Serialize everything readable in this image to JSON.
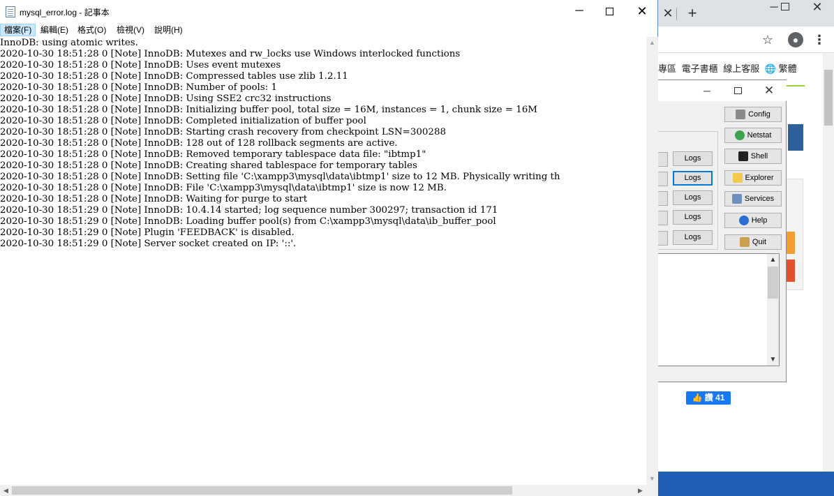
{
  "notepad": {
    "title": "mysql_error.log - 記事本",
    "controls": {
      "minimize": "─",
      "close": "✕"
    },
    "menu": [
      "檔案(F)",
      "編輯(E)",
      "格式(O)",
      "檢視(V)",
      "說明(H)"
    ],
    "lines": [
      "InnoDB: using atomic writes.",
      "2020-10-30 18:51:28 0 [Note] InnoDB: Mutexes and rw_locks use Windows interlocked functions",
      "2020-10-30 18:51:28 0 [Note] InnoDB: Uses event mutexes",
      "2020-10-30 18:51:28 0 [Note] InnoDB: Compressed tables use zlib 1.2.11",
      "2020-10-30 18:51:28 0 [Note] InnoDB: Number of pools: 1",
      "2020-10-30 18:51:28 0 [Note] InnoDB: Using SSE2 crc32 instructions",
      "2020-10-30 18:51:28 0 [Note] InnoDB: Initializing buffer pool, total size = 16M, instances = 1, chunk size = 16M",
      "2020-10-30 18:51:28 0 [Note] InnoDB: Completed initialization of buffer pool",
      "2020-10-30 18:51:28 0 [Note] InnoDB: Starting crash recovery from checkpoint LSN=300288",
      "2020-10-30 18:51:28 0 [Note] InnoDB: 128 out of 128 rollback segments are active.",
      "2020-10-30 18:51:28 0 [Note] InnoDB: Removed temporary tablespace data file: \"ibtmp1\"",
      "2020-10-30 18:51:28 0 [Note] InnoDB: Creating shared tablespace for temporary tables",
      "2020-10-30 18:51:28 0 [Note] InnoDB: Setting file 'C:\\xampp3\\mysql\\data\\ibtmp1' size to 12 MB. Physically writing th",
      "2020-10-30 18:51:28 0 [Note] InnoDB: File 'C:\\xampp3\\mysql\\data\\ibtmp1' size is now 12 MB.",
      "2020-10-30 18:51:28 0 [Note] InnoDB: Waiting for purge to start",
      "2020-10-30 18:51:29 0 [Note] InnoDB: 10.4.14 started; log sequence number 300297; transaction id 171",
      "2020-10-30 18:51:29 0 [Note] InnoDB: Loading buffer pool(s) from C:\\xampp3\\mysql\\data\\ib_buffer_pool",
      "2020-10-30 18:51:29 0 [Note] Plugin 'FEEDBACK' is disabled.",
      "2020-10-30 18:51:29 0 [Note] Server socket created on IP: '::'."
    ]
  },
  "xampp": {
    "controls": {
      "minimize": "─",
      "close": "✕"
    },
    "side_buttons": [
      {
        "label": "Config",
        "icon": "wrench-icon",
        "color": "#8a8a8a"
      },
      {
        "label": "Netstat",
        "icon": "globe-icon",
        "color": "#3fa34d"
      },
      {
        "label": "Shell",
        "icon": "terminal-icon",
        "color": "#202020"
      },
      {
        "label": "Explorer",
        "icon": "folder-icon",
        "color": "#f2c94c"
      },
      {
        "label": "Services",
        "icon": "services-icon",
        "color": "#6a8fc0"
      },
      {
        "label": "Help",
        "icon": "help-icon",
        "color": "#2a6fd6"
      },
      {
        "label": "Quit",
        "icon": "quit-icon",
        "color": "#c8a050"
      }
    ],
    "logs_label": "Logs"
  },
  "chrome": {
    "tab_close": "✕",
    "new_tab": "+",
    "controls": {
      "minimize": "─",
      "close": "✕"
    },
    "star": "☆",
    "menu": "⋮",
    "site_nav": [
      "專區",
      "電子書櫃",
      "線上客服",
      "🌐 繁體"
    ],
    "like_button": "👍 讚 41"
  }
}
